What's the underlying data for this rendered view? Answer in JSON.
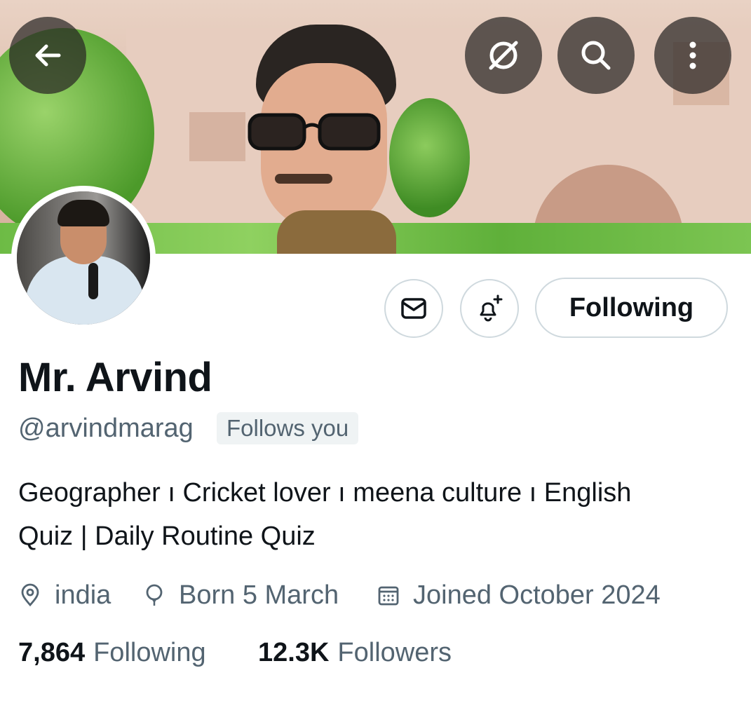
{
  "header": {
    "back_icon": "arrow-left-icon",
    "grok_icon": "grok-icon",
    "search_icon": "search-icon",
    "more_icon": "more-vertical-icon"
  },
  "profile": {
    "display_name": "Mr. Arvind",
    "handle": "@arvindmarag",
    "follows_you": "Follows you",
    "bio_line1": "Geographer ı Cricket lover ı meena culture ı English",
    "bio_line2": "Quiz | Daily Routine Quiz",
    "location": "india",
    "birthday": "Born 5 March",
    "joined": "Joined October 2024"
  },
  "actions": {
    "message_icon": "envelope-icon",
    "notify_icon": "bell-plus-icon",
    "following_label": "Following"
  },
  "stats": {
    "following_count": "7,864",
    "following_label": "Following",
    "followers_count": "12.3K",
    "followers_label": "Followers"
  },
  "colors": {
    "text_primary": "#0f1419",
    "text_secondary": "#536471",
    "border": "#cfd9de",
    "badge_bg": "#eff3f4"
  }
}
